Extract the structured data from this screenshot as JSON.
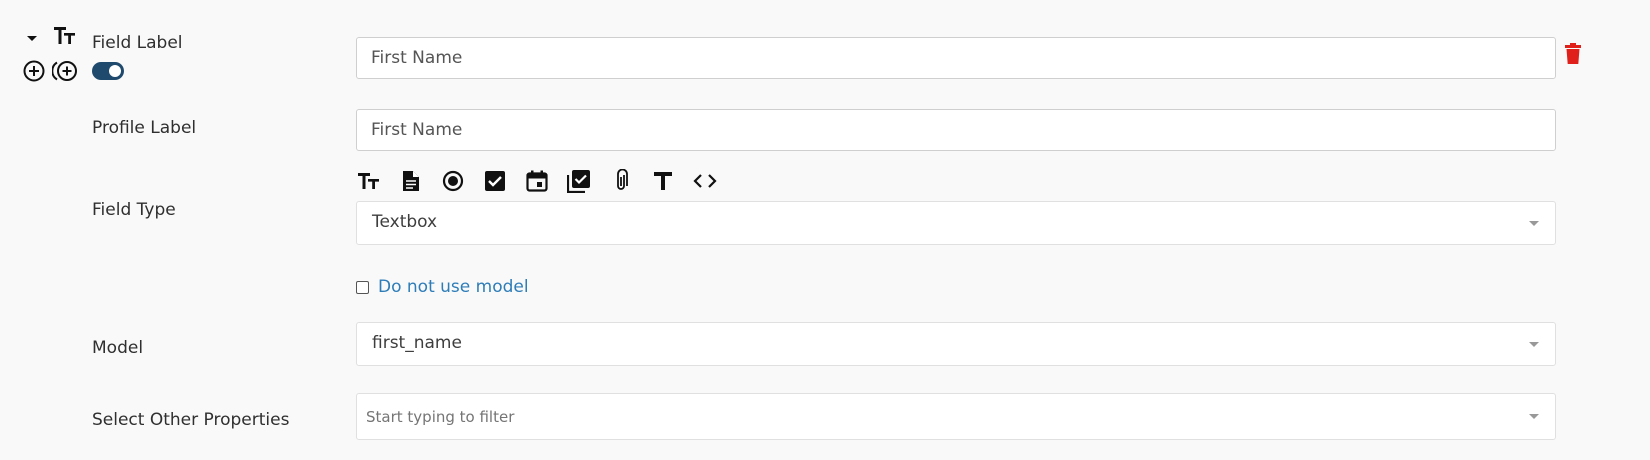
{
  "row": {
    "field_label": "Field Label",
    "field_label_value": "First Name",
    "profile_label": "Profile Label",
    "profile_label_value": "First Name",
    "field_type_label": "Field Type",
    "field_type_value": "Textbox",
    "do_not_use_model_label": "Do not use model",
    "model_label": "Model",
    "model_value": "first_name",
    "other_props_label": "Select Other Properties",
    "other_props_placeholder": "Start typing to filter"
  },
  "field_type_icons": [
    "textbox-icon",
    "document-icon",
    "radio-icon",
    "checkbox-icon",
    "calendar-icon",
    "multi-checkbox-icon",
    "attachment-icon",
    "text-icon",
    "code-icon"
  ],
  "colors": {
    "accent": "#1f4a6e",
    "link": "#2e7db8",
    "danger": "#e0201b",
    "background": "#f9f9f9"
  }
}
